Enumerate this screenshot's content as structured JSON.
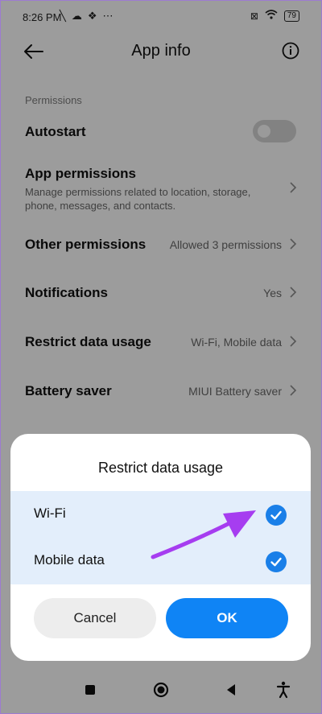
{
  "status_bar": {
    "time": "8:26 PM",
    "battery": "79"
  },
  "header": {
    "title": "App info"
  },
  "permissions": {
    "section_label": "Permissions",
    "autostart_label": "Autostart",
    "app_permissions_label": "App permissions",
    "app_permissions_desc": "Manage permissions related to location, storage, phone, messages, and contacts.",
    "other_permissions_label": "Other permissions",
    "other_permissions_value": "Allowed 3 permissions",
    "notifications_label": "Notifications",
    "notifications_value": "Yes",
    "restrict_label": "Restrict data usage",
    "restrict_value": "Wi-Fi, Mobile data",
    "battery_label": "Battery saver",
    "battery_value": "MIUI Battery saver"
  },
  "dialog": {
    "title": "Restrict data usage",
    "options": [
      {
        "label": "Wi-Fi",
        "checked": true
      },
      {
        "label": "Mobile data",
        "checked": true
      }
    ],
    "cancel_label": "Cancel",
    "ok_label": "OK"
  },
  "colors": {
    "accent": "#0f84f5",
    "annotation_arrow": "#a63df0"
  }
}
